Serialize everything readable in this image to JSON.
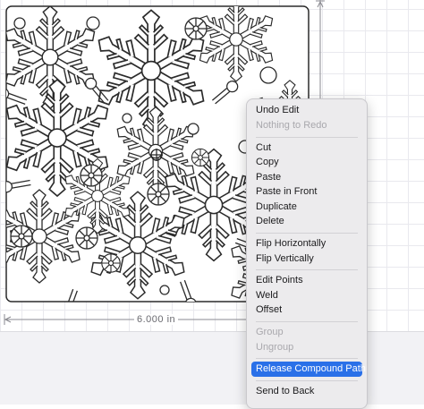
{
  "ruler": {
    "width_label": "6.000 in"
  },
  "context_menu": {
    "items": [
      {
        "label": "Undo Edit",
        "enabled": true
      },
      {
        "label": "Nothing to Redo",
        "enabled": false
      },
      {
        "label": "Cut",
        "enabled": true
      },
      {
        "label": "Copy",
        "enabled": true
      },
      {
        "label": "Paste",
        "enabled": true
      },
      {
        "label": "Paste in Front",
        "enabled": true
      },
      {
        "label": "Duplicate",
        "enabled": true
      },
      {
        "label": "Delete",
        "enabled": true
      },
      {
        "label": "Flip Horizontally",
        "enabled": true
      },
      {
        "label": "Flip Vertically",
        "enabled": true
      },
      {
        "label": "Edit Points",
        "enabled": true
      },
      {
        "label": "Weld",
        "enabled": true
      },
      {
        "label": "Offset",
        "enabled": true
      },
      {
        "label": "Group",
        "enabled": false
      },
      {
        "label": "Ungroup",
        "enabled": false
      },
      {
        "label": "Release Compound Path",
        "enabled": true,
        "highlighted": true
      },
      {
        "label": "Send to Back",
        "enabled": true
      }
    ]
  },
  "colors": {
    "highlight": "#2a70e8",
    "menu_bg": "#ecebed",
    "design_stroke": "#2b2b2b"
  }
}
